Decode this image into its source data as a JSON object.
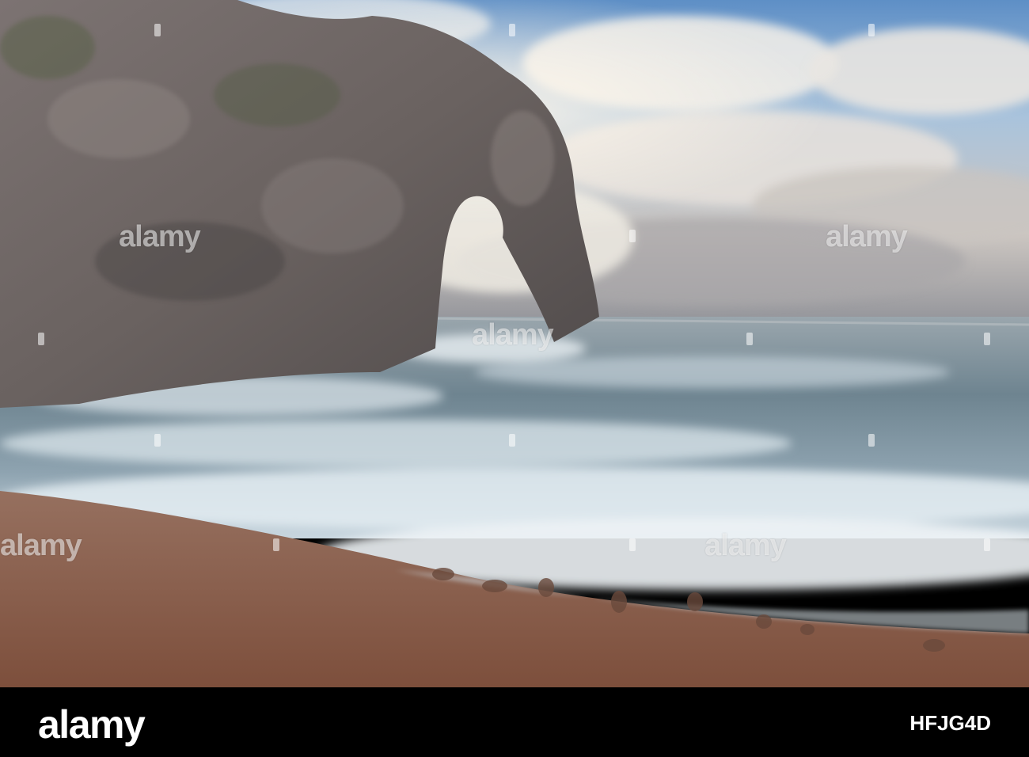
{
  "watermark": {
    "text": "alamy",
    "marks": [
      {
        "id": "wm-top-left"
      },
      {
        "id": "wm-top-mid"
      },
      {
        "id": "wm-top-right"
      },
      {
        "id": "wm-bottom-left"
      },
      {
        "id": "wm-bottom-mid"
      },
      {
        "id": "wm-bottom-right"
      }
    ]
  },
  "footer": {
    "logo": "alamy",
    "image_id": "HFJG4D"
  },
  "colors": {
    "sky": "#8fb3d6",
    "cloud": "#e8e6e2",
    "rock": "#6b6462",
    "sea": "#6f8592",
    "foam": "#dfe8ee",
    "sand": "#8a5d4b",
    "bar": "#000000"
  }
}
